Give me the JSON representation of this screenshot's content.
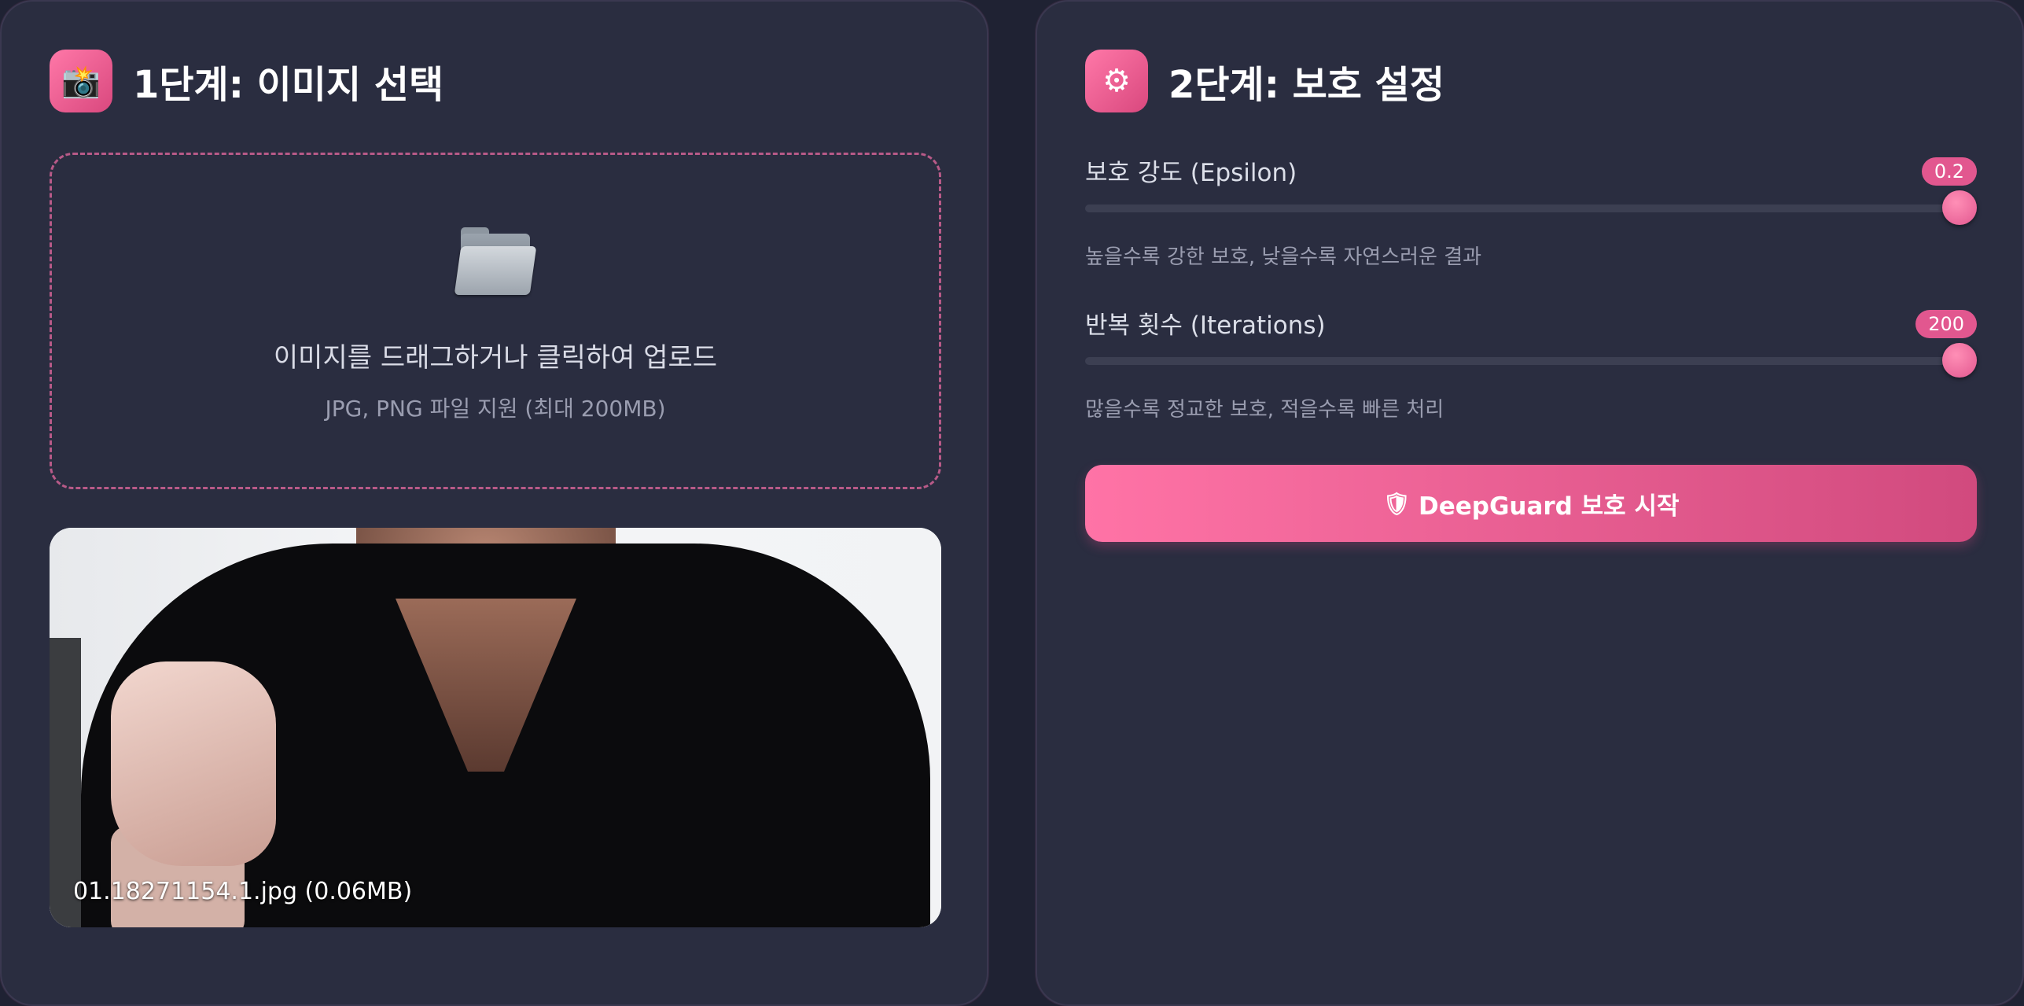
{
  "step1": {
    "icon": "camera-icon",
    "icon_glyph": "📸",
    "title": "1단계: 이미지 선택",
    "dropzone": {
      "icon": "folder-icon",
      "title": "이미지를 드래그하거나 클릭하여 업로드",
      "subtitle": "JPG, PNG 파일 지원 (최대 200MB)"
    },
    "preview": {
      "caption": "01.18271154.1.jpg (0.06MB)"
    }
  },
  "step2": {
    "icon": "gear-icon",
    "icon_glyph": "⚙",
    "title": "2단계: 보호 설정",
    "epsilon": {
      "label": "보호 강도 (Epsilon)",
      "value": "0.2",
      "slider_fraction": 1.0,
      "hint": "높을수록 강한 보호, 낮을수록 자연스러운 결과"
    },
    "iterations": {
      "label": "반복 횟수 (Iterations)",
      "value": "200",
      "slider_fraction": 1.0,
      "hint": "많을수록 정교한 보호, 적을수록 빠른 처리"
    },
    "start_button": {
      "icon": "shield-icon",
      "icon_glyph": "🛡",
      "label": "DeepGuard 보호 시작"
    }
  },
  "colors": {
    "background": "#1f2233",
    "panel": "#2a2d40",
    "accent": "#e2578f"
  }
}
